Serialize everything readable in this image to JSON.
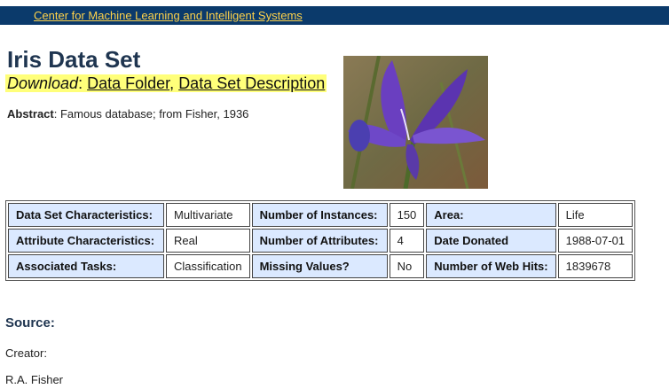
{
  "header": {
    "link_text": "Center for Machine Learning and Intelligent Systems"
  },
  "title": "Iris Data Set",
  "download": {
    "label": "Download",
    "separator": ":",
    "data_folder": "Data Folder",
    "comma": ",",
    "description": "Data Set Description"
  },
  "abstract": {
    "label": "Abstract",
    "text": ": Famous database; from Fisher, 1936"
  },
  "photo": {
    "subject": "iris-flower-photo"
  },
  "info_table": {
    "rows": [
      [
        "Data Set Characteristics:",
        "Multivariate",
        "Number of Instances:",
        "150",
        "Area:",
        "Life"
      ],
      [
        "Attribute Characteristics:",
        "Real",
        "Number of Attributes:",
        "4",
        "Date Donated",
        "1988-07-01"
      ],
      [
        "Associated Tasks:",
        "Classification",
        "Missing Values?",
        "No",
        "Number of Web Hits:",
        "1839678"
      ]
    ]
  },
  "source": {
    "heading": "Source:",
    "creator_label": "Creator:",
    "creator_name": "R.A. Fisher"
  },
  "colors": {
    "header_bg": "#0b3a6b",
    "header_link": "#ffd24a",
    "highlight": "#ffff7a",
    "key_cell": "#dbe9ff"
  }
}
